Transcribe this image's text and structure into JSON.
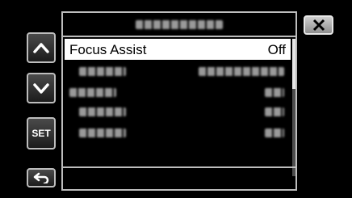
{
  "menu": {
    "selected_item": {
      "label": "Focus Assist",
      "value": "Off"
    }
  },
  "icons": {
    "up": "chevron-up-icon",
    "down": "chevron-down-icon",
    "back": "return-arrow-icon",
    "close": "close-icon"
  },
  "buttons": {
    "set_label": "SET"
  },
  "colors": {
    "highlight": "#ffffff",
    "border": "#bdbdbd",
    "background": "#000000"
  }
}
